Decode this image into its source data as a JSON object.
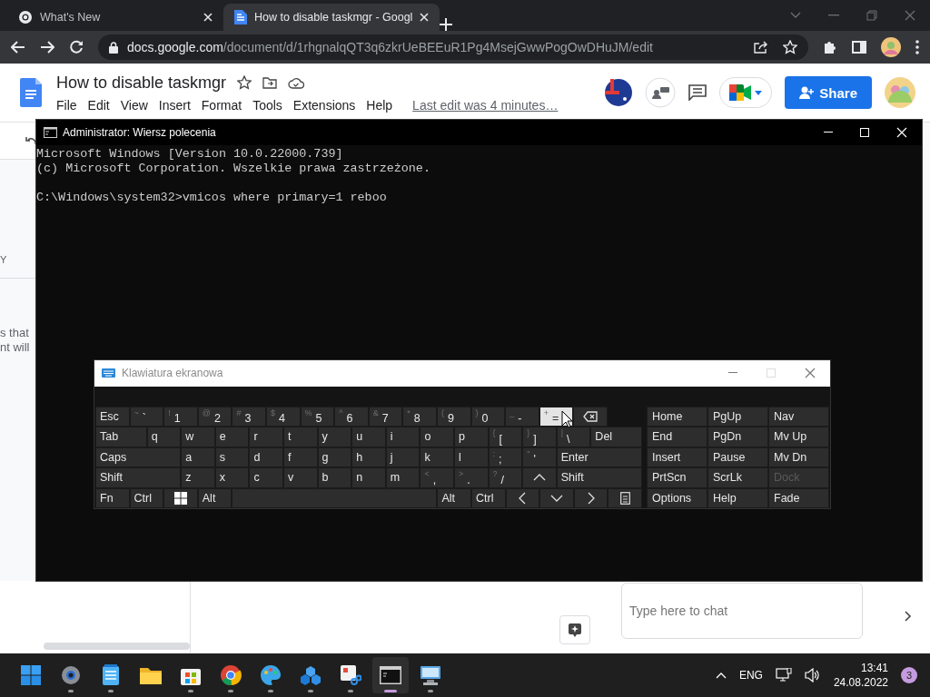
{
  "browser": {
    "tabs": [
      {
        "title": "What's New",
        "selected": false
      },
      {
        "title": "How to disable taskmgr - Googl",
        "selected": true
      }
    ],
    "url": {
      "host": "docs.google.com",
      "path": "/document/d/1rhgnalqQT3q6zkrUeBEEuR1Pg4MsejGwwPogOwDHuJM/edit"
    }
  },
  "doc": {
    "title": "How to disable taskmgr",
    "menu": [
      "File",
      "Edit",
      "View",
      "Insert",
      "Format",
      "Tools",
      "Extensions",
      "Help"
    ],
    "last_edit": "Last edit was 4 minutes…",
    "share": "Share",
    "fragments": [
      "Y",
      "s that",
      "nt will"
    ],
    "chat_placeholder": "Type here to chat"
  },
  "console": {
    "title": "Administrator: Wiersz polecenia",
    "lines": [
      "Microsoft Windows [Version 10.0.22000.739]",
      "(c) Microsoft Corporation. Wszelkie prawa zastrzeżone."
    ],
    "prompt": "C:\\Windows\\system32>vmicos where primary=1 reboo"
  },
  "keyboard": {
    "title": "Klawiatura ekranowa",
    "rows": [
      {
        "keys": [
          {
            "kind": "key",
            "label": "Esc",
            "hovered": false
          },
          {
            "kind": "key",
            "shift": "~",
            "label": "`",
            "hovered": false
          },
          {
            "kind": "key",
            "shift": "!",
            "label": "1",
            "hovered": false
          },
          {
            "kind": "key",
            "shift": "@",
            "label": "2",
            "hovered": false
          },
          {
            "kind": "key",
            "shift": "#",
            "label": "3",
            "hovered": false
          },
          {
            "kind": "key",
            "shift": "$",
            "label": "4",
            "hovered": false
          },
          {
            "kind": "key",
            "shift": "%",
            "label": "5",
            "hovered": false
          },
          {
            "kind": "key",
            "shift": "^",
            "label": "6",
            "hovered": false
          },
          {
            "kind": "key",
            "shift": "&",
            "label": "7",
            "hovered": false
          },
          {
            "kind": "key",
            "shift": "*",
            "label": "8",
            "hovered": false
          },
          {
            "kind": "key",
            "shift": "(",
            "label": "9",
            "hovered": false
          },
          {
            "kind": "key",
            "shift": ")",
            "label": "0",
            "hovered": false
          },
          {
            "kind": "key",
            "shift": "_",
            "label": "-",
            "hovered": false
          },
          {
            "kind": "key",
            "shift": "+",
            "label": "=",
            "hovered": true
          },
          {
            "kind": "backspace",
            "hovered": false
          }
        ]
      },
      {
        "keys": [
          {
            "kind": "wide",
            "label": "Tab",
            "hovered": false
          },
          {
            "kind": "key",
            "label": "q",
            "hovered": false
          },
          {
            "kind": "key",
            "label": "w",
            "hovered": false
          },
          {
            "kind": "key",
            "label": "e",
            "hovered": false
          },
          {
            "kind": "key",
            "label": "r",
            "hovered": false
          },
          {
            "kind": "key",
            "label": "t",
            "hovered": false
          },
          {
            "kind": "key",
            "label": "y",
            "hovered": false
          },
          {
            "kind": "key",
            "label": "u",
            "hovered": false
          },
          {
            "kind": "key",
            "label": "i",
            "hovered": false
          },
          {
            "kind": "key",
            "label": "o",
            "hovered": false
          },
          {
            "kind": "key",
            "label": "p",
            "hovered": false
          },
          {
            "kind": "key",
            "shift": "{",
            "label": "[",
            "hovered": false
          },
          {
            "kind": "key",
            "shift": "}",
            "label": "]",
            "hovered": false
          },
          {
            "kind": "key",
            "shift": "|",
            "label": "\\",
            "hovered": false
          },
          {
            "kind": "wide",
            "label": "Del",
            "hovered": false
          }
        ]
      },
      {
        "keys": [
          {
            "kind": "wide",
            "label": "Caps",
            "hovered": false
          },
          {
            "kind": "key",
            "label": "a",
            "hovered": false
          },
          {
            "kind": "key",
            "label": "s",
            "hovered": false
          },
          {
            "kind": "key",
            "label": "d",
            "hovered": false
          },
          {
            "kind": "key",
            "label": "f",
            "hovered": false
          },
          {
            "kind": "key",
            "label": "g",
            "hovered": false
          },
          {
            "kind": "key",
            "label": "h",
            "hovered": false
          },
          {
            "kind": "key",
            "label": "j",
            "hovered": false
          },
          {
            "kind": "key",
            "label": "k",
            "hovered": false
          },
          {
            "kind": "key",
            "label": "l",
            "hovered": false
          },
          {
            "kind": "key",
            "shift": ":",
            "label": ";",
            "hovered": false
          },
          {
            "kind": "key",
            "shift": "\"",
            "label": "'",
            "hovered": false
          },
          {
            "kind": "wide",
            "label": "Enter",
            "hovered": false
          }
        ]
      },
      {
        "keys": [
          {
            "kind": "wide",
            "label": "Shift",
            "hovered": false
          },
          {
            "kind": "key",
            "label": "z",
            "hovered": false
          },
          {
            "kind": "key",
            "label": "x",
            "hovered": false
          },
          {
            "kind": "key",
            "label": "c",
            "hovered": false
          },
          {
            "kind": "key",
            "label": "v",
            "hovered": false
          },
          {
            "kind": "key",
            "label": "b",
            "hovered": false
          },
          {
            "kind": "key",
            "label": "n",
            "hovered": false
          },
          {
            "kind": "key",
            "label": "m",
            "hovered": false
          },
          {
            "kind": "key",
            "shift": "<",
            "label": ",",
            "hovered": false
          },
          {
            "kind": "key",
            "shift": ">",
            "label": ".",
            "hovered": false
          },
          {
            "kind": "key",
            "shift": "?",
            "label": "/",
            "hovered": false
          },
          {
            "kind": "up",
            "hovered": false
          },
          {
            "kind": "wide",
            "label": "Shift",
            "hovered": false
          }
        ]
      },
      {
        "keys": [
          {
            "kind": "key",
            "label": "Fn",
            "hovered": false
          },
          {
            "kind": "key",
            "label": "Ctrl",
            "hovered": false
          },
          {
            "kind": "windows",
            "hovered": false
          },
          {
            "kind": "key",
            "label": "Alt",
            "hovered": false
          },
          {
            "kind": "space",
            "hovered": false
          },
          {
            "kind": "key",
            "label": "Alt",
            "hovered": false
          },
          {
            "kind": "key",
            "label": "Ctrl",
            "hovered": false
          },
          {
            "kind": "left",
            "hovered": false
          },
          {
            "kind": "down",
            "hovered": false
          },
          {
            "kind": "right",
            "hovered": false
          },
          {
            "kind": "menu",
            "hovered": false
          }
        ]
      }
    ],
    "nav": [
      {
        "label": "Home",
        "disabled": false
      },
      {
        "label": "PgUp",
        "disabled": false
      },
      {
        "label": "Nav",
        "disabled": false
      },
      {
        "label": "End",
        "disabled": false
      },
      {
        "label": "PgDn",
        "disabled": false
      },
      {
        "label": "Mv Up",
        "disabled": false
      },
      {
        "label": "Insert",
        "disabled": false
      },
      {
        "label": "Pause",
        "disabled": false
      },
      {
        "label": "Mv Dn",
        "disabled": false
      },
      {
        "label": "PrtScn",
        "disabled": false
      },
      {
        "label": "ScrLk",
        "disabled": false
      },
      {
        "label": "Dock",
        "disabled": true
      },
      {
        "label": "Options",
        "disabled": false
      },
      {
        "label": "Help",
        "disabled": false
      },
      {
        "label": "Fade",
        "disabled": false
      }
    ]
  },
  "taskbar": {
    "apps": [
      {
        "kind": "start",
        "running": false,
        "active": false
      },
      {
        "kind": "settings",
        "running": true,
        "active": false
      },
      {
        "kind": "notepad",
        "running": true,
        "active": false
      },
      {
        "kind": "folder",
        "running": false,
        "active": false
      },
      {
        "kind": "store",
        "running": true,
        "active": false
      },
      {
        "kind": "chrome",
        "running": true,
        "active": false
      },
      {
        "kind": "paint",
        "running": true,
        "active": false
      },
      {
        "kind": "cubes",
        "running": true,
        "active": false
      },
      {
        "kind": "snip",
        "running": true,
        "active": false
      },
      {
        "kind": "terminal",
        "running": true,
        "active": true
      },
      {
        "kind": "remote",
        "running": true,
        "active": false
      }
    ],
    "language": "ENG",
    "time": "13:41",
    "date": "24.08.2022",
    "badge": "3"
  }
}
